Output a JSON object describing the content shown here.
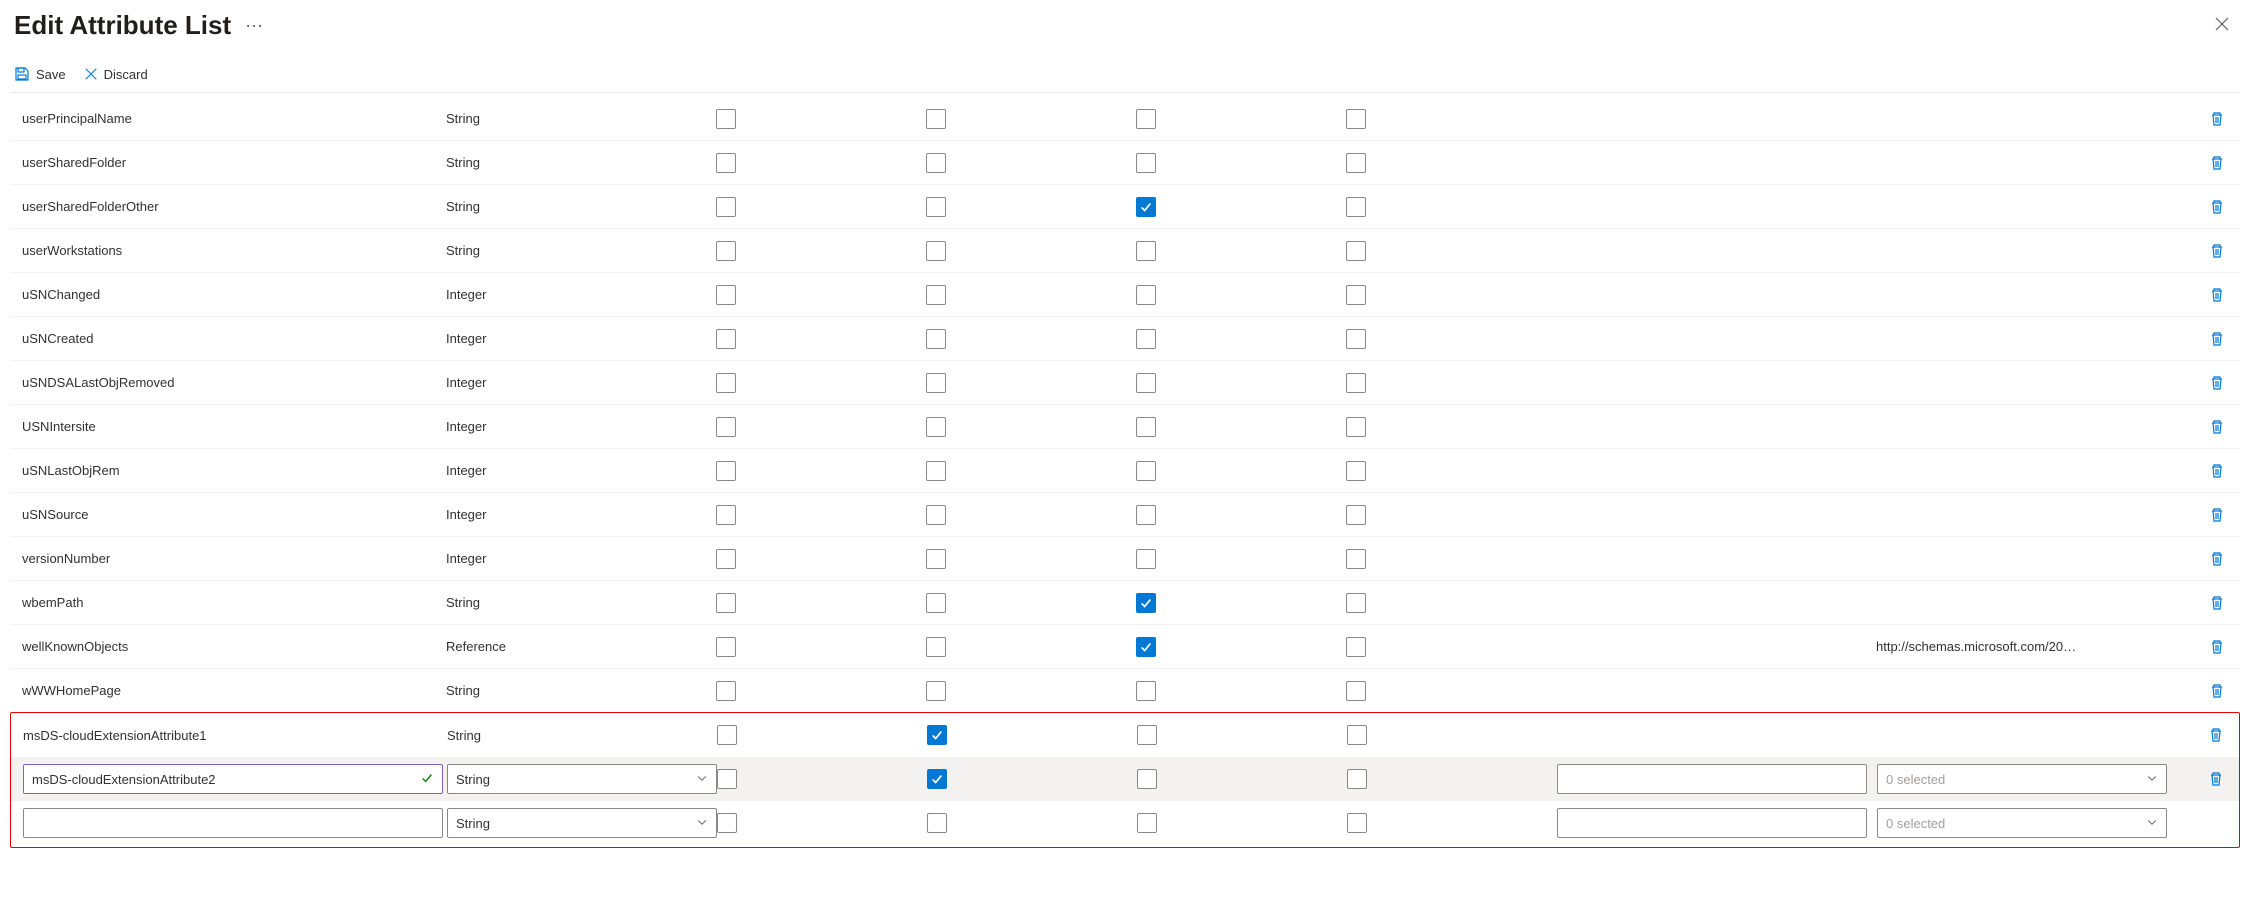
{
  "header": {
    "title": "Edit Attribute List",
    "ellipsis": "···"
  },
  "toolbar": {
    "save_label": "Save",
    "discard_label": "Discard"
  },
  "rows": [
    {
      "name": "userPrincipalName",
      "type": "String",
      "c1": false,
      "c2": false,
      "c3": false,
      "c4": false,
      "ref": ""
    },
    {
      "name": "userSharedFolder",
      "type": "String",
      "c1": false,
      "c2": false,
      "c3": false,
      "c4": false,
      "ref": ""
    },
    {
      "name": "userSharedFolderOther",
      "type": "String",
      "c1": false,
      "c2": false,
      "c3": true,
      "c4": false,
      "ref": ""
    },
    {
      "name": "userWorkstations",
      "type": "String",
      "c1": false,
      "c2": false,
      "c3": false,
      "c4": false,
      "ref": ""
    },
    {
      "name": "uSNChanged",
      "type": "Integer",
      "c1": false,
      "c2": false,
      "c3": false,
      "c4": false,
      "ref": ""
    },
    {
      "name": "uSNCreated",
      "type": "Integer",
      "c1": false,
      "c2": false,
      "c3": false,
      "c4": false,
      "ref": ""
    },
    {
      "name": "uSNDSALastObjRemoved",
      "type": "Integer",
      "c1": false,
      "c2": false,
      "c3": false,
      "c4": false,
      "ref": ""
    },
    {
      "name": "USNIntersite",
      "type": "Integer",
      "c1": false,
      "c2": false,
      "c3": false,
      "c4": false,
      "ref": ""
    },
    {
      "name": "uSNLastObjRem",
      "type": "Integer",
      "c1": false,
      "c2": false,
      "c3": false,
      "c4": false,
      "ref": ""
    },
    {
      "name": "uSNSource",
      "type": "Integer",
      "c1": false,
      "c2": false,
      "c3": false,
      "c4": false,
      "ref": ""
    },
    {
      "name": "versionNumber",
      "type": "Integer",
      "c1": false,
      "c2": false,
      "c3": false,
      "c4": false,
      "ref": ""
    },
    {
      "name": "wbemPath",
      "type": "String",
      "c1": false,
      "c2": false,
      "c3": true,
      "c4": false,
      "ref": ""
    },
    {
      "name": "wellKnownObjects",
      "type": "Reference",
      "c1": false,
      "c2": false,
      "c3": true,
      "c4": false,
      "ref": "http://schemas.microsoft.com/20…"
    },
    {
      "name": "wWWHomePage",
      "type": "String",
      "c1": false,
      "c2": false,
      "c3": false,
      "c4": false,
      "ref": ""
    }
  ],
  "edit_rows": {
    "r1": {
      "name": "msDS-cloudExtensionAttribute1",
      "type": "String",
      "c1": false,
      "c2": true,
      "c3": false,
      "c4": false
    },
    "r2": {
      "name": "msDS-cloudExtensionAttribute2",
      "type": "String",
      "c1": false,
      "c2": true,
      "c3": false,
      "c4": false,
      "selected_text": "0 selected"
    },
    "r3": {
      "name": "",
      "type": "String",
      "c1": false,
      "c2": false,
      "c3": false,
      "c4": false,
      "selected_text": "0 selected"
    }
  }
}
